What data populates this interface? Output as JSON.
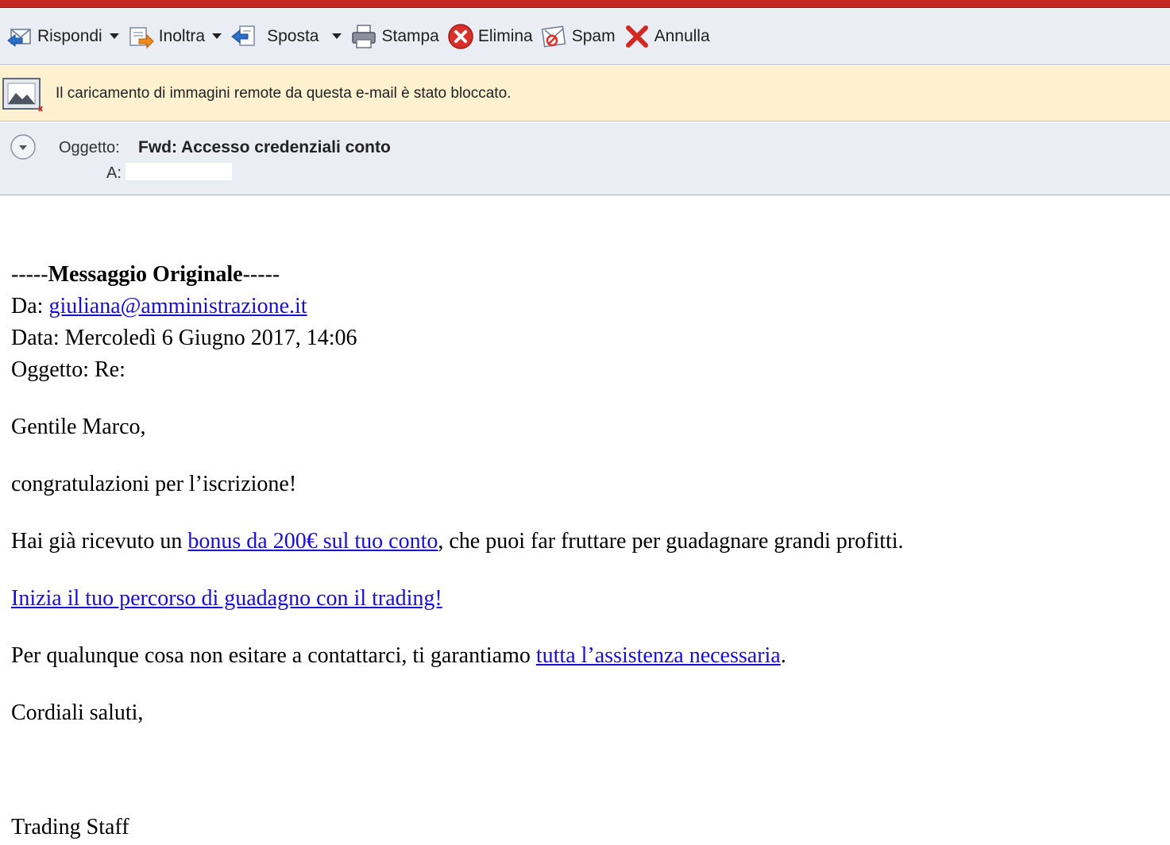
{
  "toolbar": {
    "reply_label": "Rispondi",
    "forward_label": "Inoltra",
    "move_label": "Sposta",
    "print_label": "Stampa",
    "delete_label": "Elimina",
    "spam_label": "Spam",
    "cancel_label": "Annulla"
  },
  "notice": {
    "text": "Il caricamento di immagini remote da questa e-mail è stato bloccato."
  },
  "header": {
    "subject_label": "Oggetto:",
    "subject_value": "Fwd: Accesso credenziali conto",
    "to_label": "A:"
  },
  "message": {
    "original_prefix": "-----",
    "original_title": "Messaggio Originale",
    "original_suffix": "-----",
    "from_label": "Da: ",
    "from_email": "giuliana@amministrazione.it",
    "date_line": "Data: Mercoledì 6 Giugno 2017, 14:06",
    "subject_line": "Oggetto: Re:",
    "greeting": "Gentile Marco,",
    "congrats": "congratulazioni per l’iscrizione!",
    "bonus_prefix": "Hai già ricevuto un ",
    "bonus_link": "bonus da 200€ sul tuo conto",
    "bonus_suffix": ", che puoi far fruttare per guadagnare grandi profitti.",
    "trading_link": "Inizia il tuo percorso di guadagno con il trading!",
    "assist_prefix": "Per qualunque cosa non esitare a contattarci, ti garantiamo ",
    "assist_link": "tutta l’assistenza necessaria",
    "assist_suffix": ".",
    "closing": "Cordiali saluti,",
    "signature": "Trading Staff"
  },
  "colors": {
    "toolbar_bg": "#eaedf3",
    "notice_bg": "#fdf1cf",
    "link": "#1a0dda",
    "top_accent": "#c62828"
  },
  "icons": [
    "reply-icon",
    "forward-icon",
    "move-icon",
    "print-icon",
    "delete-icon",
    "spam-icon",
    "cancel-icon",
    "blocked-image-icon",
    "expand-toggle-icon"
  ]
}
